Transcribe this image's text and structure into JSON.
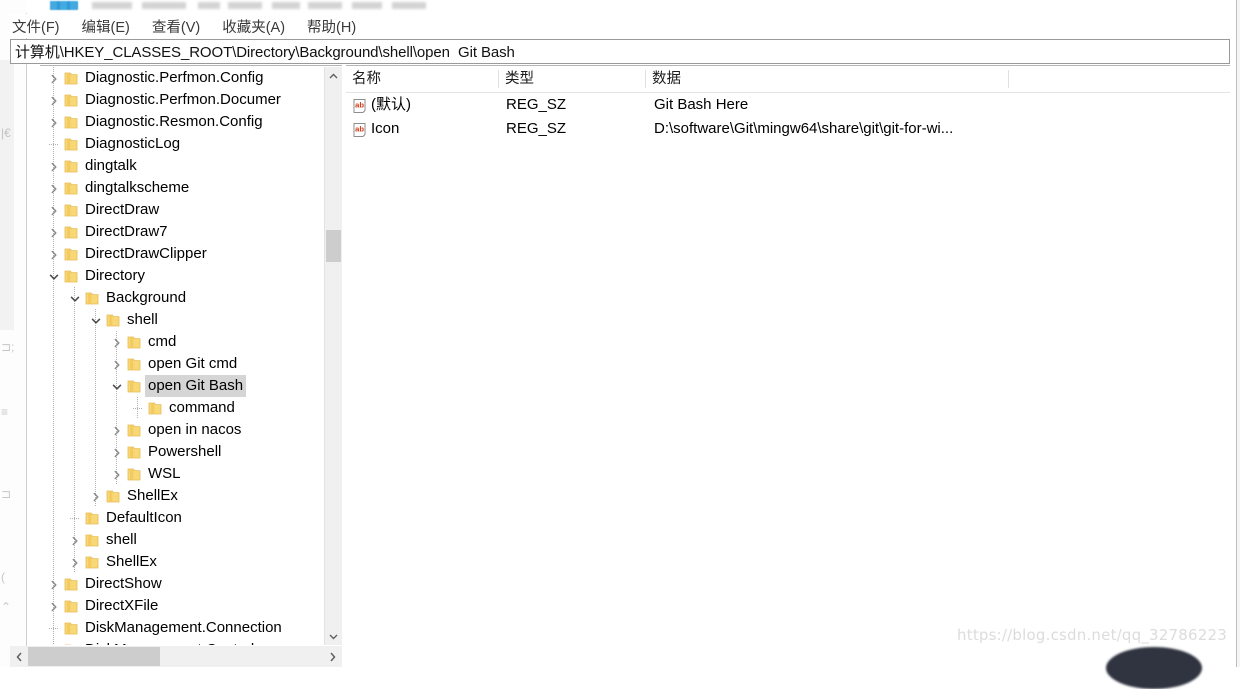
{
  "window": {
    "title_bar_visible_fragment": "",
    "menu": [
      {
        "label": "文件(F)",
        "name": "menu-file"
      },
      {
        "label": "编辑(E)",
        "name": "menu-edit"
      },
      {
        "label": "查看(V)",
        "name": "menu-view"
      },
      {
        "label": "收藏夹(A)",
        "name": "menu-favorites"
      },
      {
        "label": "帮助(H)",
        "name": "menu-help"
      }
    ]
  },
  "address_bar": {
    "value": "计算机\\HKEY_CLASSES_ROOT\\Directory\\Background\\shell\\open  Git Bash",
    "placeholder": ""
  },
  "tree": {
    "items": [
      {
        "label": "Diagnostic.Perfmon.Config",
        "depth": 1,
        "expander": "collapsed",
        "selected": false
      },
      {
        "label": "Diagnostic.Perfmon.Documer",
        "depth": 1,
        "expander": "collapsed",
        "selected": false
      },
      {
        "label": "Diagnostic.Resmon.Config",
        "depth": 1,
        "expander": "collapsed",
        "selected": false
      },
      {
        "label": "DiagnosticLog",
        "depth": 1,
        "expander": "none",
        "selected": false
      },
      {
        "label": "dingtalk",
        "depth": 1,
        "expander": "collapsed",
        "selected": false
      },
      {
        "label": "dingtalkscheme",
        "depth": 1,
        "expander": "collapsed",
        "selected": false
      },
      {
        "label": "DirectDraw",
        "depth": 1,
        "expander": "collapsed",
        "selected": false
      },
      {
        "label": "DirectDraw7",
        "depth": 1,
        "expander": "collapsed",
        "selected": false
      },
      {
        "label": "DirectDrawClipper",
        "depth": 1,
        "expander": "collapsed",
        "selected": false
      },
      {
        "label": "Directory",
        "depth": 1,
        "expander": "expanded",
        "selected": false
      },
      {
        "label": "Background",
        "depth": 2,
        "expander": "expanded",
        "selected": false
      },
      {
        "label": "shell",
        "depth": 3,
        "expander": "expanded",
        "selected": false
      },
      {
        "label": "cmd",
        "depth": 4,
        "expander": "collapsed",
        "selected": false
      },
      {
        "label": "open Git cmd",
        "depth": 4,
        "expander": "collapsed",
        "selected": false
      },
      {
        "label": "open  Git Bash",
        "depth": 4,
        "expander": "expanded",
        "selected": true
      },
      {
        "label": "command",
        "depth": 5,
        "expander": "none",
        "selected": false
      },
      {
        "label": "open in nacos",
        "depth": 4,
        "expander": "collapsed",
        "selected": false
      },
      {
        "label": "Powershell",
        "depth": 4,
        "expander": "collapsed",
        "selected": false
      },
      {
        "label": "WSL",
        "depth": 4,
        "expander": "collapsed",
        "selected": false
      },
      {
        "label": "ShellEx",
        "depth": 3,
        "expander": "collapsed",
        "selected": false
      },
      {
        "label": "DefaultIcon",
        "depth": 2,
        "expander": "none",
        "selected": false
      },
      {
        "label": "shell",
        "depth": 2,
        "expander": "collapsed",
        "selected": false
      },
      {
        "label": "ShellEx",
        "depth": 2,
        "expander": "collapsed",
        "selected": false
      },
      {
        "label": "DirectShow",
        "depth": 1,
        "expander": "collapsed",
        "selected": false
      },
      {
        "label": "DirectXFile",
        "depth": 1,
        "expander": "collapsed",
        "selected": false
      },
      {
        "label": "DiskManagement.Connection",
        "depth": 1,
        "expander": "none",
        "selected": false
      },
      {
        "label": "DiskManagement.Control",
        "depth": 1,
        "expander": "collapsed",
        "selected": false
      }
    ]
  },
  "list": {
    "columns": [
      {
        "label": "名称",
        "name": "column-name"
      },
      {
        "label": "类型",
        "name": "column-type"
      },
      {
        "label": "数据",
        "name": "column-data"
      }
    ],
    "rows": [
      {
        "icon": "string-value-icon",
        "name": "(默认)",
        "type": "REG_SZ",
        "data": "Git Bash Here"
      },
      {
        "icon": "string-value-icon",
        "name": "Icon",
        "type": "REG_SZ",
        "data": "D:\\software\\Git\\mingw64\\share\\git\\git-for-wi..."
      }
    ]
  },
  "scrollbars": {
    "vertical_up": "▲",
    "vertical_down": "▼",
    "horizontal_left": "◀",
    "horizontal_right": "▶"
  },
  "watermark": {
    "text": "https://blog.csdn.net/qq_32786223"
  },
  "colors": {
    "selection": "#d5d5d5",
    "folder": "#f8d775",
    "folder_dark": "#e6bd55",
    "chevron": "#8a8a8a",
    "scrollbar_track": "#f0f0f0",
    "scrollbar_thumb": "#cdcdcd",
    "watermark": "#dcdcdc",
    "reg_icon_text": "#d63a12"
  }
}
